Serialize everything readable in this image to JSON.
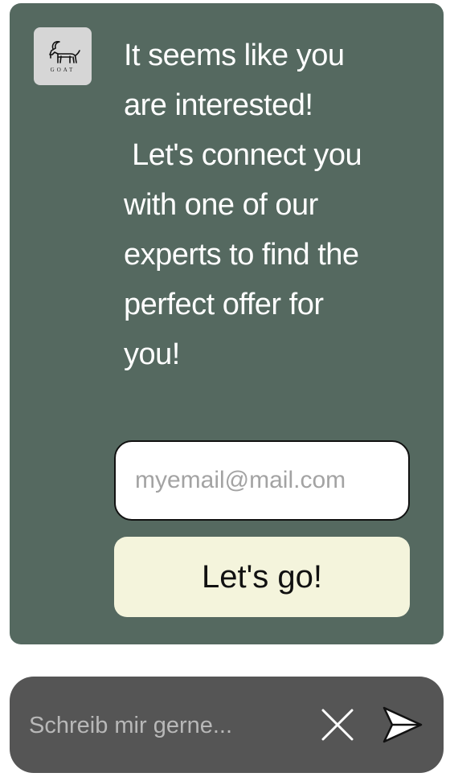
{
  "card": {
    "logo": {
      "icon": "goat-logo-icon",
      "text": "GOAT"
    },
    "message": "It seems like you\nare interested!\n Let's connect you\nwith one of our\nexperts to find the\nperfect offer for\nyou!",
    "email_placeholder": "myemail@mail.com",
    "email_value": "",
    "submit_label": "Let's go!"
  },
  "chat_bar": {
    "input_placeholder": "Schreib mir gerne...",
    "input_value": "",
    "clear_icon": "close-icon",
    "send_icon": "send-icon"
  },
  "colors": {
    "card_bg": "#556960",
    "button_bg": "#f4f4dc",
    "chat_bar_bg": "#555555",
    "logo_bg": "#d6d6d6"
  }
}
